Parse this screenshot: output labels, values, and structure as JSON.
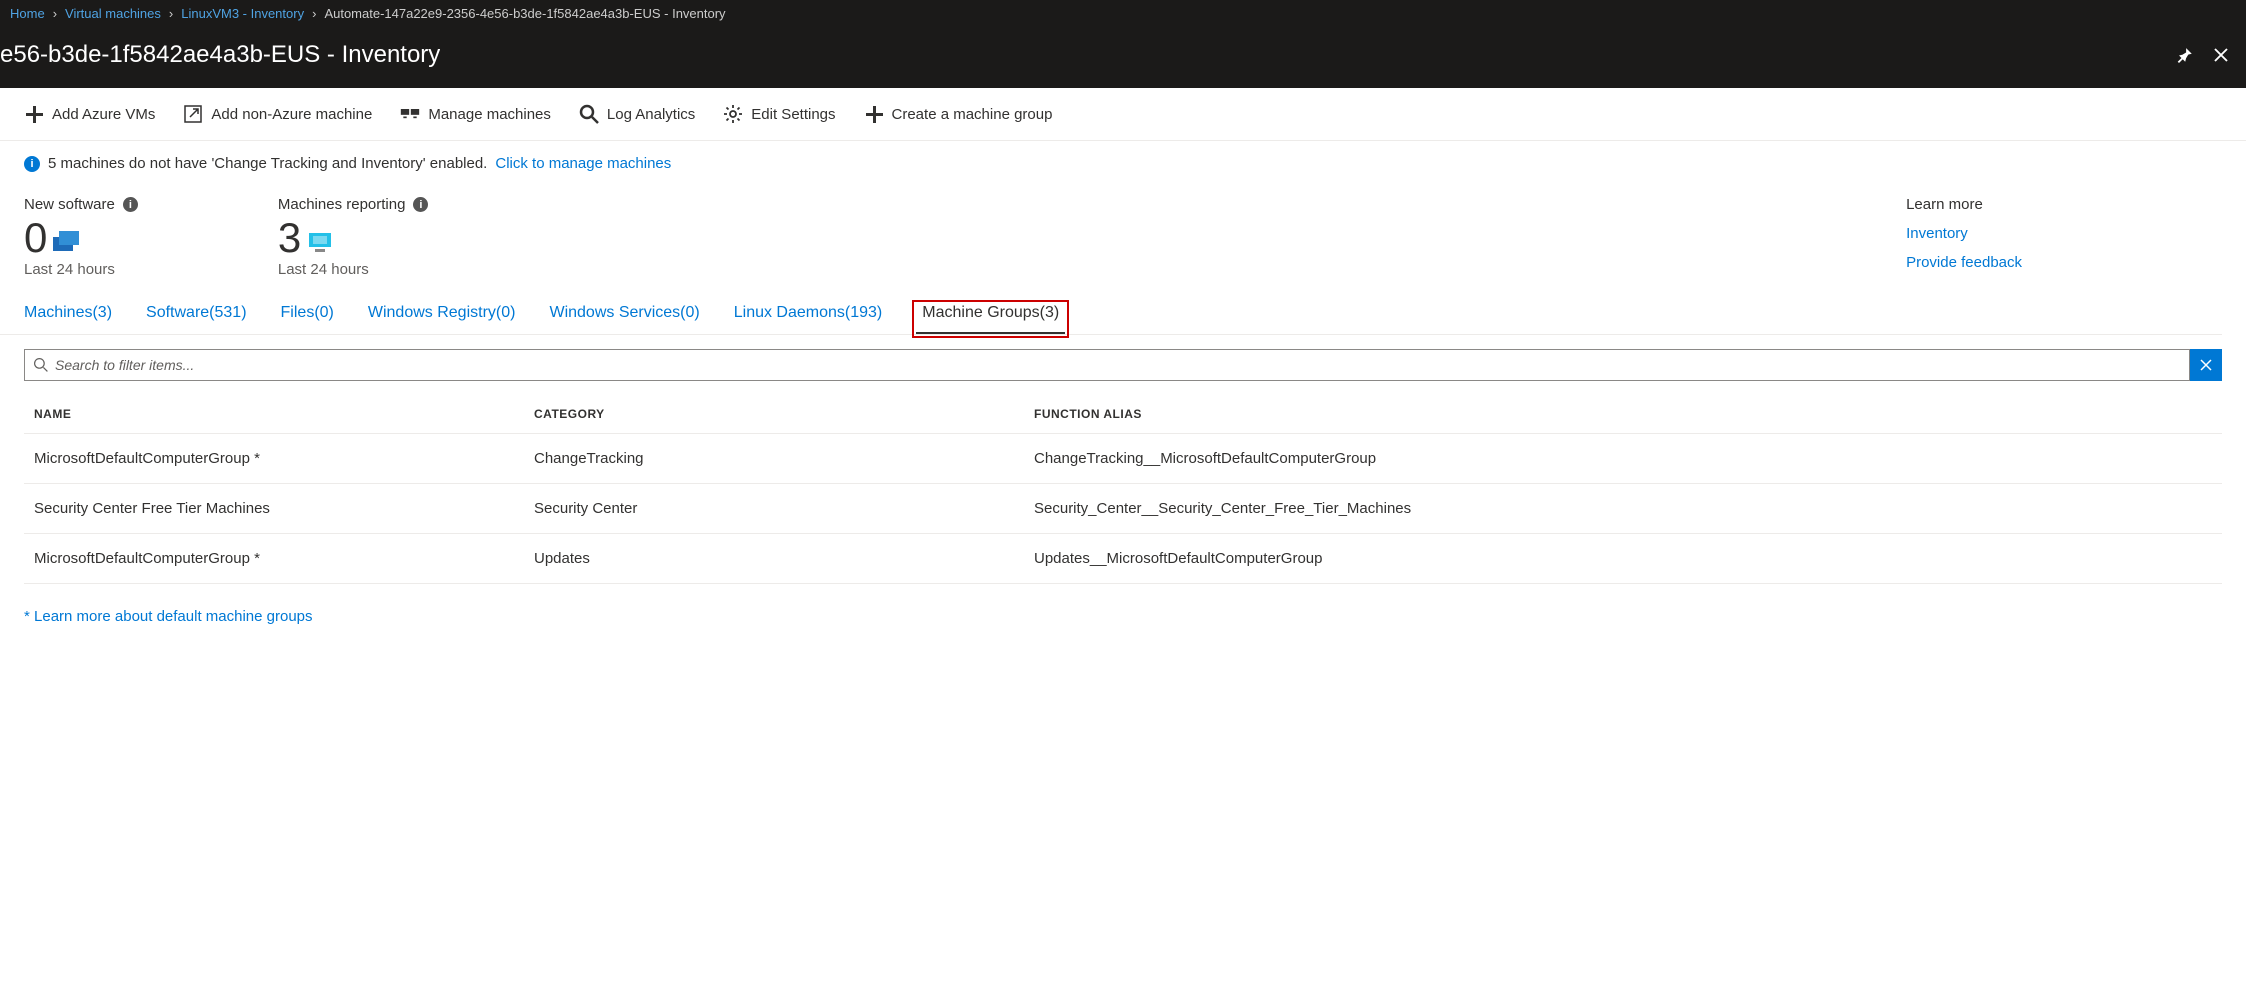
{
  "breadcrumb": {
    "items": [
      {
        "label": "Home"
      },
      {
        "label": "Virtual machines"
      },
      {
        "label": "LinuxVM3 - Inventory"
      }
    ],
    "current": "Automate-147a22e9-2356-4e56-b3de-1f5842ae4a3b-EUS - Inventory"
  },
  "page_title": "e56-b3de-1f5842ae4a3b-EUS - Inventory",
  "toolbar": {
    "add_azure": "Add Azure VMs",
    "add_non_azure": "Add non-Azure machine",
    "manage_machines": "Manage machines",
    "log_analytics": "Log Analytics",
    "edit_settings": "Edit Settings",
    "create_group": "Create a machine group"
  },
  "info_strip": {
    "text": "5 machines do not have 'Change Tracking and Inventory' enabled.",
    "link": "Click to manage machines"
  },
  "stats": {
    "new_software": {
      "label": "New software",
      "value": "0",
      "sub": "Last 24 hours"
    },
    "machines_reporting": {
      "label": "Machines reporting",
      "value": "3",
      "sub": "Last 24 hours"
    }
  },
  "learn_more": {
    "title": "Learn more",
    "inventory": "Inventory",
    "feedback": "Provide feedback"
  },
  "tabs": [
    {
      "label": "Machines(3)"
    },
    {
      "label": "Software(531)"
    },
    {
      "label": "Files(0)"
    },
    {
      "label": "Windows Registry(0)"
    },
    {
      "label": "Windows Services(0)"
    },
    {
      "label": "Linux Daemons(193)"
    },
    {
      "label": "Machine Groups(3)"
    }
  ],
  "active_tab_index": 6,
  "search": {
    "placeholder": "Search to filter items..."
  },
  "grid": {
    "headers": {
      "name": "NAME",
      "category": "CATEGORY",
      "func": "FUNCTION ALIAS"
    },
    "rows": [
      {
        "name": "MicrosoftDefaultComputerGroup *",
        "category": "ChangeTracking",
        "func": "ChangeTracking__MicrosoftDefaultComputerGroup"
      },
      {
        "name": "Security Center Free Tier Machines",
        "category": "Security Center",
        "func": "Security_Center__Security_Center_Free_Tier_Machines"
      },
      {
        "name": "MicrosoftDefaultComputerGroup *",
        "category": "Updates",
        "func": "Updates__MicrosoftDefaultComputerGroup"
      }
    ]
  },
  "footnote": {
    "text": "* Learn more about default machine groups"
  }
}
